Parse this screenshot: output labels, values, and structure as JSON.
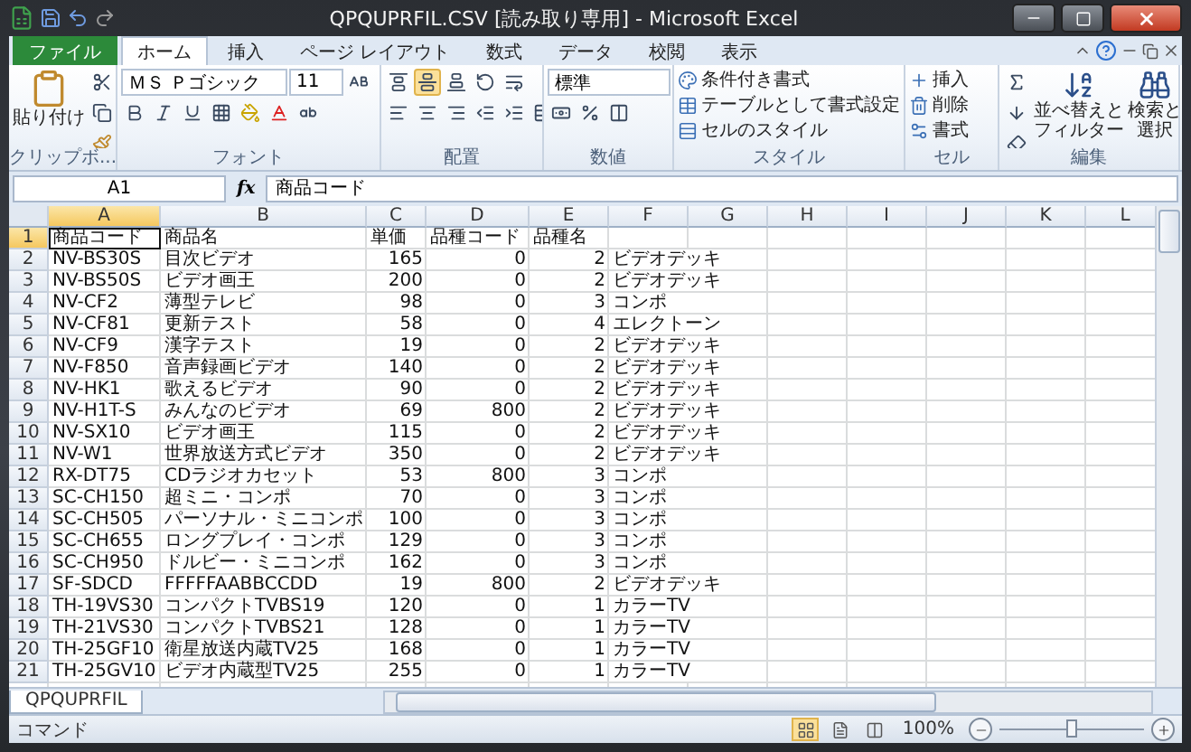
{
  "window": {
    "title": "QPQUPRFIL.CSV  [読み取り専用]  -  Microsoft Excel"
  },
  "tabs": [
    {
      "label": "ファイル",
      "kind": "file",
      "selected": false
    },
    {
      "label": "ホーム",
      "kind": "tab",
      "selected": true
    },
    {
      "label": "挿入",
      "kind": "tab",
      "selected": false
    },
    {
      "label": "ページ レイアウト",
      "kind": "tab",
      "selected": false
    },
    {
      "label": "数式",
      "kind": "tab",
      "selected": false
    },
    {
      "label": "データ",
      "kind": "tab",
      "selected": false
    },
    {
      "label": "校閲",
      "kind": "tab",
      "selected": false
    },
    {
      "label": "表示",
      "kind": "tab",
      "selected": false
    }
  ],
  "ribbon": {
    "groups": [
      {
        "label": "クリップボ...",
        "kind": "clipboard",
        "paste": "貼り付け"
      },
      {
        "label": "フォント",
        "kind": "font",
        "font": "ＭＳ Ｐゴシック",
        "size": "11"
      },
      {
        "label": "配置",
        "kind": "align"
      },
      {
        "label": "数値",
        "kind": "number",
        "format": "標準"
      },
      {
        "label": "スタイル",
        "kind": "styles",
        "items": [
          "条件付き書式",
          "テーブルとして書式設定",
          "セルのスタイル"
        ]
      },
      {
        "label": "セル",
        "kind": "cells",
        "items": [
          "挿入",
          "削除",
          "書式"
        ]
      },
      {
        "label": "編集",
        "kind": "editing",
        "items": [
          "並べ替えとフィルター",
          "検索と選択"
        ]
      }
    ]
  },
  "formula_bar": {
    "name_box": "A1",
    "fx": "fx",
    "value": "商品コード"
  },
  "columns": [
    {
      "label": "A",
      "selected": true
    },
    {
      "label": "B",
      "selected": false
    },
    {
      "label": "C",
      "selected": false
    },
    {
      "label": "D",
      "selected": false
    },
    {
      "label": "E",
      "selected": false
    },
    {
      "label": "F",
      "selected": false
    },
    {
      "label": "G",
      "selected": false
    },
    {
      "label": "H",
      "selected": false
    },
    {
      "label": "I",
      "selected": false
    },
    {
      "label": "J",
      "selected": false
    },
    {
      "label": "K",
      "selected": false
    },
    {
      "label": "L",
      "selected": false
    }
  ],
  "rows": [
    {
      "num": "1",
      "kind": "text",
      "selected": true,
      "cells": [
        "商品コード",
        "商品名",
        "単価",
        "品種コード",
        "品種名"
      ]
    },
    {
      "num": "2",
      "kind": "data",
      "selected": false,
      "cells": [
        "NV-BS30S",
        "目次ビデオ",
        "165",
        "0",
        "2",
        "ビデオデッキ"
      ]
    },
    {
      "num": "3",
      "kind": "data",
      "selected": false,
      "cells": [
        "NV-BS50S",
        "ビデオ画王",
        "200",
        "0",
        "2",
        "ビデオデッキ"
      ]
    },
    {
      "num": "4",
      "kind": "data",
      "selected": false,
      "cells": [
        "NV-CF2",
        "薄型テレビ",
        "98",
        "0",
        "3",
        "コンポ"
      ]
    },
    {
      "num": "5",
      "kind": "data",
      "selected": false,
      "cells": [
        "NV-CF81",
        "更新テスト",
        "58",
        "0",
        "4",
        "エレクトーン"
      ]
    },
    {
      "num": "6",
      "kind": "data",
      "selected": false,
      "cells": [
        "NV-CF9",
        "漢字テスト",
        "19",
        "0",
        "2",
        "ビデオデッキ"
      ]
    },
    {
      "num": "7",
      "kind": "data",
      "selected": false,
      "cells": [
        "NV-F850",
        "音声録画ビデオ",
        "140",
        "0",
        "2",
        "ビデオデッキ"
      ]
    },
    {
      "num": "8",
      "kind": "data",
      "selected": false,
      "cells": [
        "NV-HK1",
        "歌えるビデオ",
        "90",
        "0",
        "2",
        "ビデオデッキ"
      ]
    },
    {
      "num": "9",
      "kind": "data",
      "selected": false,
      "cells": [
        "NV-H1T-S",
        "みんなのビデオ",
        "69",
        "800",
        "2",
        "ビデオデッキ"
      ]
    },
    {
      "num": "10",
      "kind": "data",
      "selected": false,
      "cells": [
        "NV-SX10",
        "ビデオ画王",
        "115",
        "0",
        "2",
        "ビデオデッキ"
      ]
    },
    {
      "num": "11",
      "kind": "data",
      "selected": false,
      "cells": [
        "NV-W1",
        "世界放送方式ビデオ",
        "350",
        "0",
        "2",
        "ビデオデッキ"
      ]
    },
    {
      "num": "12",
      "kind": "data",
      "selected": false,
      "cells": [
        "RX-DT75",
        "CDラジオカセット",
        "53",
        "800",
        "3",
        "コンポ"
      ]
    },
    {
      "num": "13",
      "kind": "data",
      "selected": false,
      "cells": [
        "SC-CH150",
        "超ミニ・コンポ",
        "70",
        "0",
        "3",
        "コンポ"
      ]
    },
    {
      "num": "14",
      "kind": "data",
      "selected": false,
      "cells": [
        "SC-CH505",
        "パーソナル・ミニコンポ",
        "100",
        "0",
        "3",
        "コンポ"
      ]
    },
    {
      "num": "15",
      "kind": "data",
      "selected": false,
      "cells": [
        "SC-CH655",
        "ロングプレイ・コンポ",
        "129",
        "0",
        "3",
        "コンポ"
      ]
    },
    {
      "num": "16",
      "kind": "data",
      "selected": false,
      "cells": [
        "SC-CH950",
        "ドルビー・ミニコンポ",
        "162",
        "0",
        "3",
        "コンポ"
      ]
    },
    {
      "num": "17",
      "kind": "data",
      "selected": false,
      "cells": [
        "SF-SDCD",
        "FFFFFAABBCCDD",
        "19",
        "800",
        "2",
        "ビデオデッキ"
      ]
    },
    {
      "num": "18",
      "kind": "data",
      "selected": false,
      "cells": [
        "TH-19VS30",
        "コンパクトTVBS19",
        "120",
        "0",
        "1",
        "カラーTV"
      ]
    },
    {
      "num": "19",
      "kind": "data",
      "selected": false,
      "cells": [
        "TH-21VS30",
        "コンパクトTVBS21",
        "128",
        "0",
        "1",
        "カラーTV"
      ]
    },
    {
      "num": "20",
      "kind": "data",
      "selected": false,
      "cells": [
        "TH-25GF10",
        "衛星放送内蔵TV25",
        "168",
        "0",
        "1",
        "カラーTV"
      ]
    },
    {
      "num": "21",
      "kind": "data",
      "selected": false,
      "cells": [
        "TH-25GV10",
        "ビデオ内蔵型TV25",
        "255",
        "0",
        "1",
        "カラーTV"
      ]
    }
  ],
  "sheet_tabs": [
    {
      "label": "QPQUPRFIL",
      "selected": true
    }
  ],
  "status_bar": {
    "mode": "コマンド",
    "views": [
      {
        "kind": "normal",
        "selected": true
      },
      {
        "kind": "layout",
        "selected": false
      },
      {
        "kind": "pagebreak",
        "selected": false
      }
    ],
    "zoom": "100%",
    "zoom_slider": {
      "level": 0.5
    }
  }
}
